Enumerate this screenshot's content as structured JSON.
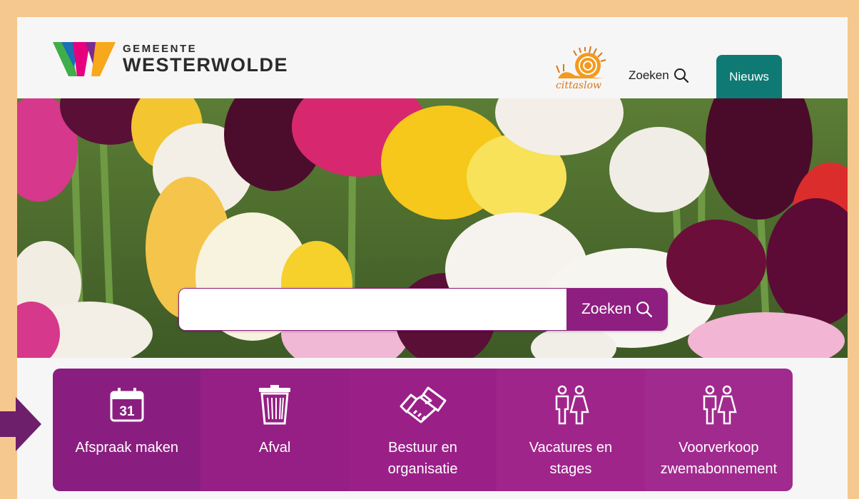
{
  "header": {
    "logo": {
      "line1": "GEMEENTE",
      "line2": "WESTERWOLDE"
    },
    "cittaslow_label": "cittaslow",
    "search_label": "Zoeken",
    "search_icon": "search-icon",
    "news_label": "Nieuws"
  },
  "hero": {
    "search": {
      "value": "",
      "placeholder": "",
      "button_label": "Zoeken"
    }
  },
  "tiles": [
    {
      "label": "Afspraak maken",
      "icon": "calendar-icon",
      "icon_text": "31"
    },
    {
      "label": "Afval",
      "icon": "trash-bin-icon"
    },
    {
      "label": "Bestuur en\norganisatie",
      "icon": "handshake-icon"
    },
    {
      "label": "Vacatures en\nstages",
      "icon": "people-icon"
    },
    {
      "label": "Voorverkoop\nzwemabonnement",
      "icon": "people-icon"
    }
  ],
  "colors": {
    "frame": "#f5c88f",
    "brand_purple": "#8e1e7f",
    "news_teal": "#0f7a73",
    "arrow": "#6d1f6b"
  }
}
